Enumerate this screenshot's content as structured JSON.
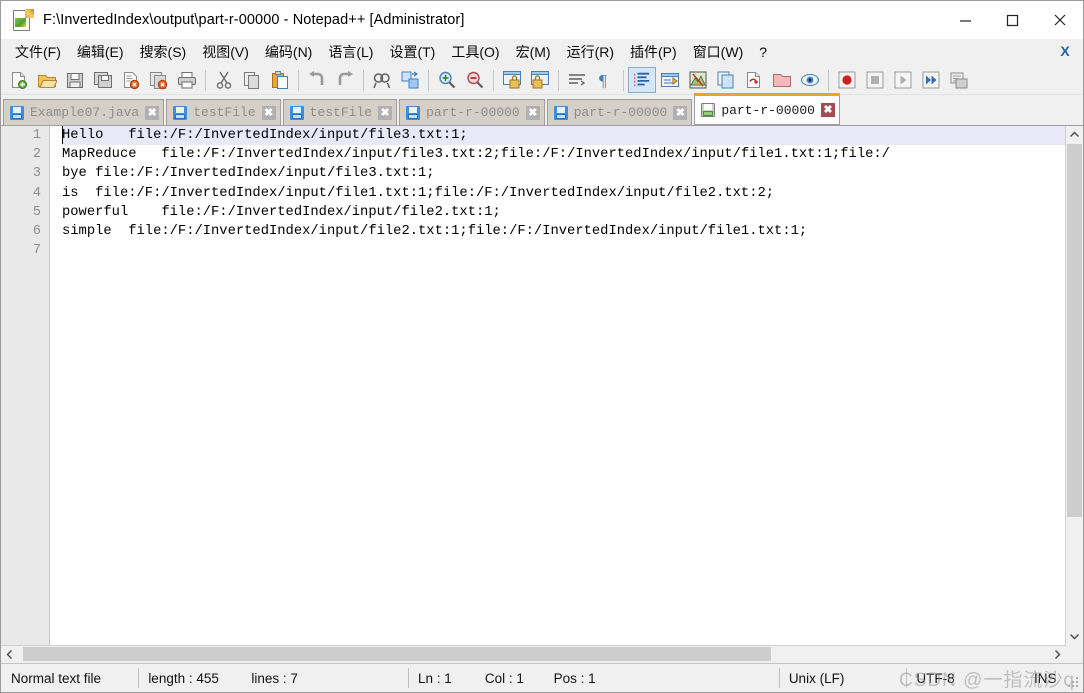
{
  "window": {
    "title": "F:\\InvertedIndex\\output\\part-r-00000 - Notepad++ [Administrator]",
    "icon": "notepadpp-icon",
    "minimize_label": "—",
    "maximize_label": "□",
    "close_label": "✕"
  },
  "menu": {
    "items": [
      {
        "label": "文件(F)"
      },
      {
        "label": "编辑(E)"
      },
      {
        "label": "搜索(S)"
      },
      {
        "label": "视图(V)"
      },
      {
        "label": "编码(N)"
      },
      {
        "label": "语言(L)"
      },
      {
        "label": "设置(T)"
      },
      {
        "label": "工具(O)"
      },
      {
        "label": "宏(M)"
      },
      {
        "label": "运行(R)"
      },
      {
        "label": "插件(P)"
      },
      {
        "label": "窗口(W)"
      },
      {
        "label": "?"
      }
    ],
    "close_document_label": "X"
  },
  "toolbar": {
    "groups": [
      [
        "new-file-icon",
        "open-file-icon",
        "save-icon",
        "save-all-icon",
        "close-file-icon",
        "close-all-icon",
        "print-icon"
      ],
      [
        "cut-icon",
        "copy-icon",
        "paste-icon"
      ],
      [
        "undo-icon",
        "redo-icon"
      ],
      [
        "find-icon",
        "replace-icon"
      ],
      [
        "zoom-in-icon",
        "zoom-out-icon"
      ],
      [
        "sync-vertical-icon",
        "sync-horizontal-icon"
      ],
      [
        "word-wrap-icon",
        "show-all-characters-icon"
      ],
      [
        "indent-guide-icon",
        "user-defined-dialog-icon",
        "show-document-map-icon",
        "function-list-icon",
        "document-switcher-icon",
        "folder-as-workspace-icon",
        "monitoring-icon"
      ],
      [
        "record-macro-icon",
        "stop-macro-icon",
        "play-macro-icon",
        "run-macro-multiple-icon",
        "save-macro-icon"
      ]
    ],
    "selected": "indent-guide-icon"
  },
  "tabs": [
    {
      "label": "Example07.java",
      "active": false,
      "icon": "saved-file-icon",
      "close": "✖"
    },
    {
      "label": "testFile",
      "active": false,
      "icon": "saved-file-icon",
      "close": "✖"
    },
    {
      "label": "testFile",
      "active": false,
      "icon": "saved-file-icon",
      "close": "✖"
    },
    {
      "label": "part-r-00000",
      "active": false,
      "icon": "saved-file-icon",
      "close": "✖"
    },
    {
      "label": "part-r-00000",
      "active": false,
      "icon": "saved-file-icon",
      "close": "✖"
    },
    {
      "label": "part-r-00000",
      "active": true,
      "icon": "saved-file-icon",
      "close": "✖"
    }
  ],
  "editor": {
    "line_numbers": [
      "1",
      "2",
      "3",
      "4",
      "5",
      "6",
      "7"
    ],
    "current_line": 1,
    "lines": [
      "Hello   file:/F:/InvertedIndex/input/file3.txt:1;",
      "MapReduce   file:/F:/InvertedIndex/input/file3.txt:2;file:/F:/InvertedIndex/input/file1.txt:1;file:/",
      "bye file:/F:/InvertedIndex/input/file3.txt:1;",
      "is  file:/F:/InvertedIndex/input/file1.txt:1;file:/F:/InvertedIndex/input/file2.txt:2;",
      "powerful    file:/F:/InvertedIndex/input/file2.txt:1;",
      "simple  file:/F:/InvertedIndex/input/file2.txt:1;file:/F:/InvertedIndex/input/file1.txt:1;",
      ""
    ]
  },
  "scrollbars": {
    "vertical_up": "∧",
    "vertical_down": "∨",
    "horizontal_left": "‹",
    "horizontal_right": "›"
  },
  "statusbar": {
    "file_type": "Normal text file",
    "length": "length : 455",
    "lines": "lines : 7",
    "ln": "Ln : 1",
    "col": "Col : 1",
    "pos": "Pos : 1",
    "eol": "Unix (LF)",
    "encoding": "UTF-8",
    "insert_mode": "INS"
  },
  "watermark": {
    "text": "CSDN @一指流沙q"
  },
  "colors": {
    "accent_tab": "#f0a030",
    "selection": "#e8e8f8",
    "chrome": "#f0f0f0",
    "tab_inactive": "#d4d0c8"
  }
}
